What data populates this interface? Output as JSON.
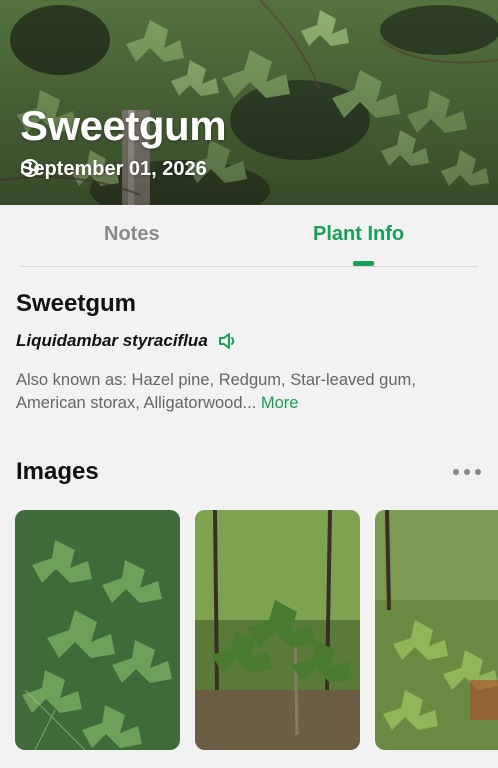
{
  "hero": {
    "title": "Sweetgum",
    "date": "September 01, 2026",
    "date_icon": "clock-icon"
  },
  "tabs": [
    {
      "label": "Notes",
      "active": false
    },
    {
      "label": "Plant Info",
      "active": true
    }
  ],
  "colors": {
    "accent": "#18a05a",
    "inactive_tab": "#8a8a8a",
    "background": "#f2f2f2"
  },
  "plant": {
    "common_name": "Sweetgum",
    "scientific_name": "Liquidambar styraciflua",
    "pronounce_icon": "speaker-icon",
    "aka_text": "Also known as: Hazel pine, Redgum, Star-leaved gum, American storax, Alligatorwood...",
    "more_label": "More"
  },
  "images_section": {
    "title": "Images",
    "menu_icon": "more-dots-icon",
    "thumbnails": [
      {
        "subject": "sweetgum leaves close-up"
      },
      {
        "subject": "young sweetgum tree in forest"
      },
      {
        "subject": "sweetgum shrub foliage"
      }
    ]
  }
}
